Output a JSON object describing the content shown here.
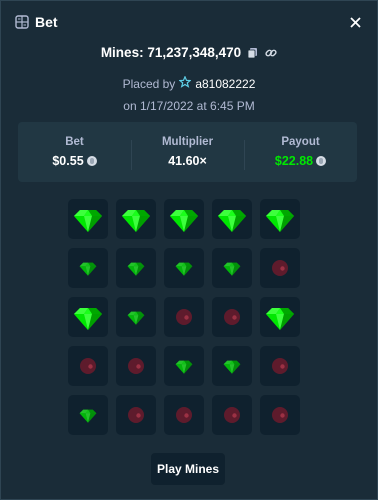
{
  "modal": {
    "title": "Bet",
    "close_icon": "close-icon"
  },
  "bet_info": {
    "mines_label": "Mines: 71,237,348,470",
    "placed_by_label": "Placed by",
    "user": "a81082222",
    "date": "on 1/17/2022 at 6:45 PM"
  },
  "stats": {
    "bet_label": "Bet",
    "bet_value": "$0.55",
    "multiplier_label": "Multiplier",
    "multiplier_value": "41.60×",
    "payout_label": "Payout",
    "payout_value": "$22.88"
  },
  "grid": {
    "rows": [
      [
        "gem-revealed",
        "gem-revealed",
        "gem-revealed",
        "gem-revealed",
        "gem-revealed"
      ],
      [
        "gem",
        "gem",
        "gem",
        "gem",
        "mine"
      ],
      [
        "gem-revealed",
        "gem",
        "mine",
        "mine",
        "gem-revealed"
      ],
      [
        "mine",
        "mine",
        "gem",
        "gem",
        "mine"
      ],
      [
        "gem",
        "mine",
        "mine",
        "mine",
        "mine"
      ]
    ]
  },
  "actions": {
    "play_label": "Play Mines"
  },
  "colors": {
    "background": "#1a2c38",
    "panel": "#213743",
    "tile": "#0f212e",
    "gem": "#00e701",
    "mine": "#8a1c2e",
    "muted_text": "#b1bad3"
  }
}
